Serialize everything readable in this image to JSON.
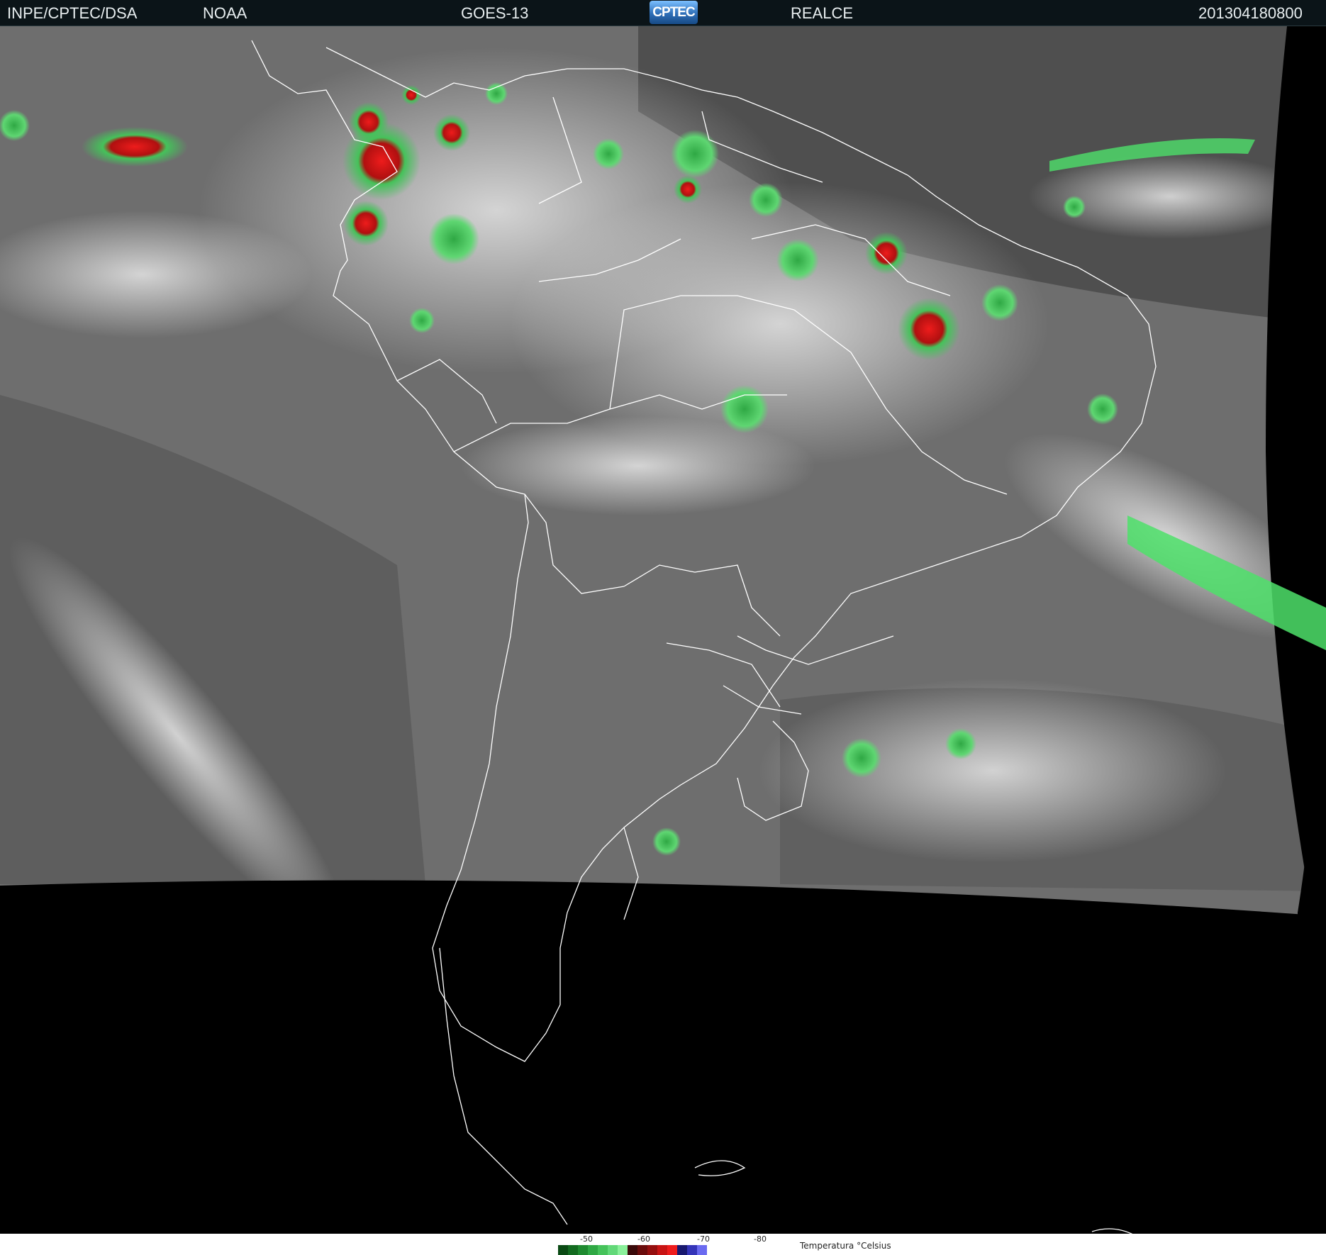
{
  "header": {
    "agency": "INPE/CPTEC/DSA",
    "source": "NOAA",
    "satellite": "GOES-13",
    "logo_text": "CPTEC",
    "product": "REALCE",
    "timestamp": "201304180800"
  },
  "legend": {
    "title": "Temperatura °Celsius",
    "ticks": [
      "-50",
      "-60",
      "-70",
      "-80"
    ],
    "colors": [
      "#0a4a14",
      "#136b20",
      "#1f8a30",
      "#2fa844",
      "#45c25a",
      "#62d878",
      "#8af09a",
      "#3a0a0a",
      "#6a0c0c",
      "#950f0f",
      "#c81414",
      "#ee1c1c",
      "#18186e",
      "#3434b8",
      "#6a6af0"
    ]
  },
  "map": {
    "colors": {
      "cold_green": "#3fd85a",
      "cold_red": "#e01818",
      "coast": "#ffffff",
      "space": "#000000"
    }
  }
}
